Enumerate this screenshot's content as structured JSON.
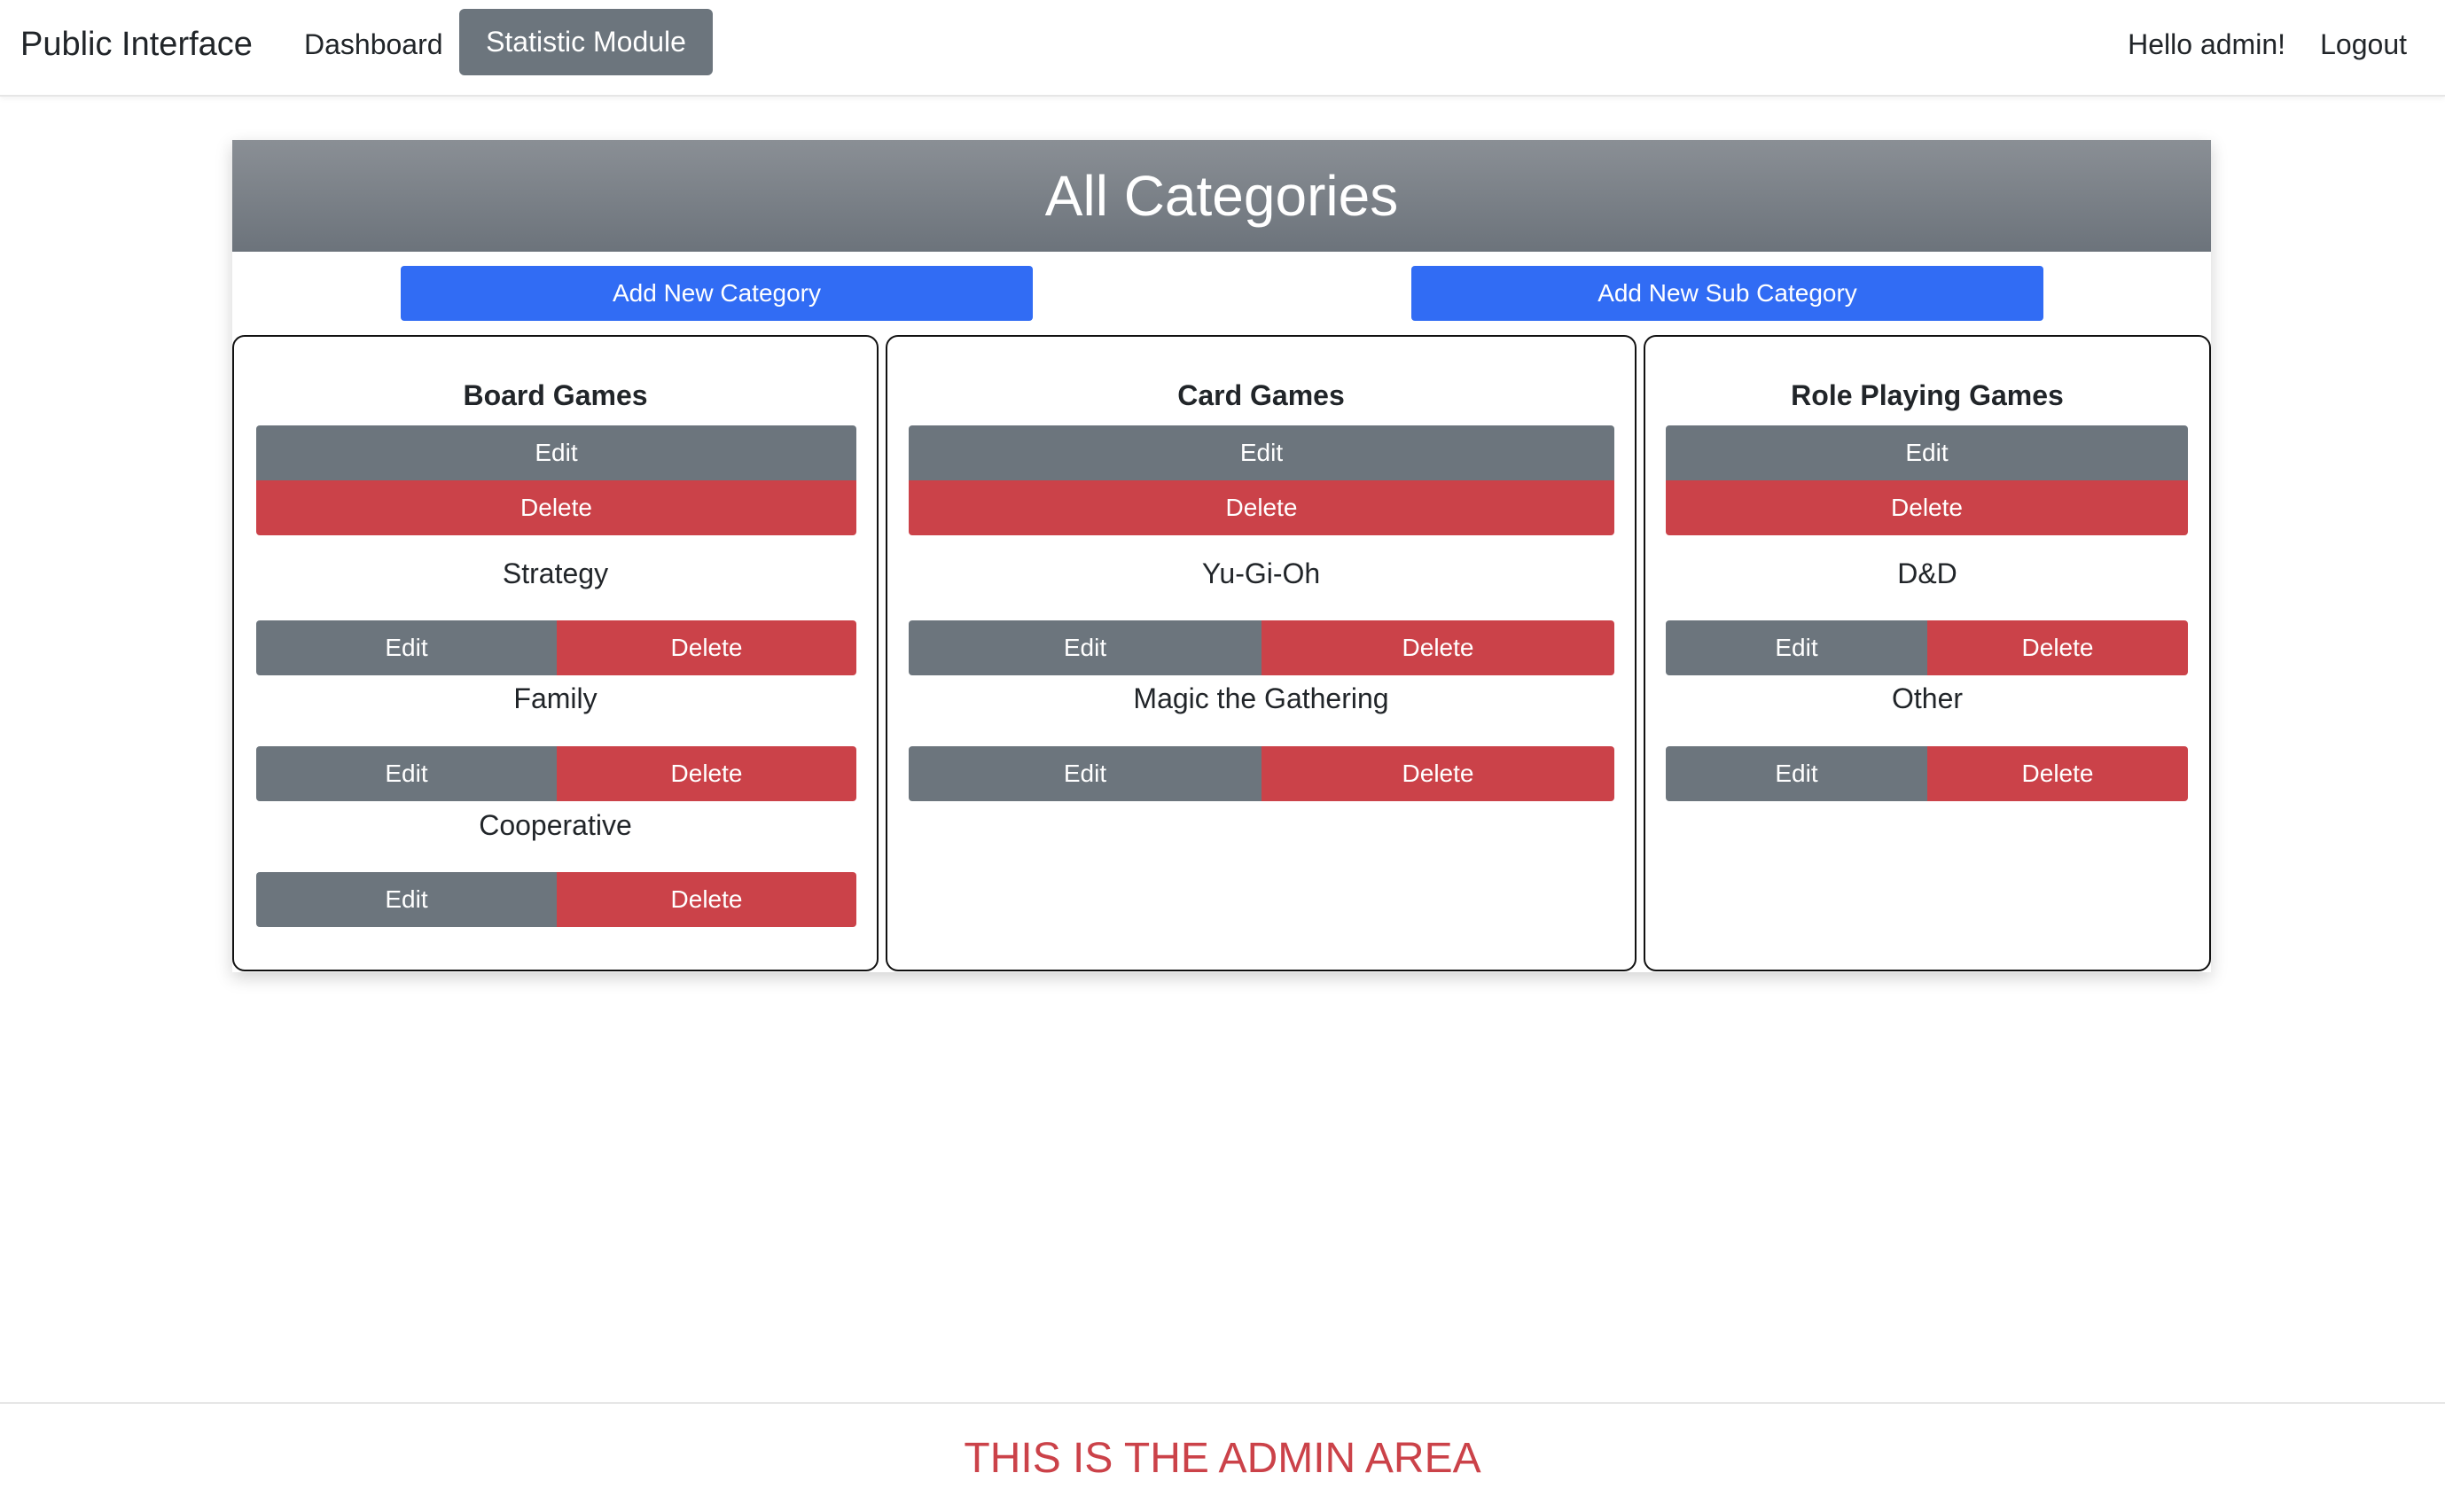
{
  "navbar": {
    "brand": "Public Interface",
    "dashboard": "Dashboard",
    "statistic_module": "Statistic Module",
    "greeting": "Hello admin!",
    "logout": "Logout"
  },
  "main": {
    "title": "All Categories",
    "add_category_label": "Add New Category",
    "add_sub_category_label": "Add New Sub Category"
  },
  "buttons": {
    "edit": "Edit",
    "delete": "Delete"
  },
  "categories": [
    {
      "name": "Board Games",
      "subcategories": [
        "Strategy",
        "Family",
        "Cooperative"
      ]
    },
    {
      "name": "Card Games",
      "subcategories": [
        "Yu-Gi-Oh",
        "Magic the Gathering"
      ]
    },
    {
      "name": "Role Playing Games",
      "subcategories": [
        "D&D",
        "Other"
      ]
    }
  ],
  "footer": {
    "text": "THIS IS THE ADMIN AREA"
  },
  "colors": {
    "primary": "#316cf4",
    "secondary": "#6c757d",
    "danger": "#cb4249"
  }
}
